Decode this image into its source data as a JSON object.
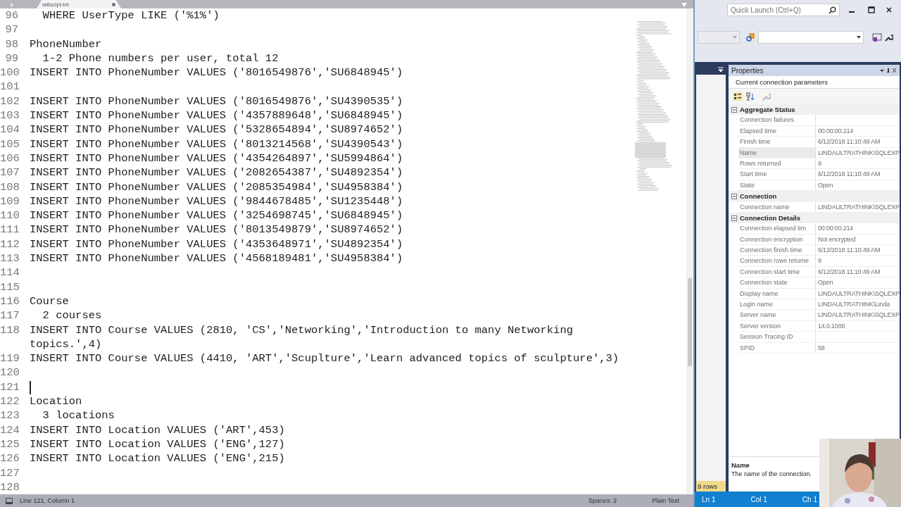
{
  "editor": {
    "tab": {
      "title": "la6scipt.txt",
      "modified": true
    },
    "lines": [
      {
        "number": "96",
        "text": "  WHERE UserType LIKE ('%1%')",
        "caret": false
      },
      {
        "number": "97",
        "caret": false
      },
      {
        "number": "98",
        "text": "PhoneNumber",
        "caret": false
      },
      {
        "number": "99",
        "text": "  1-2 Phone numbers per user, total 12",
        "caret": false
      },
      {
        "number": "100",
        "text": "INSERT INTO PhoneNumber VALUES ('8016549876','SU6848945')",
        "caret": false
      },
      {
        "number": "101",
        "caret": false
      },
      {
        "number": "102",
        "text": "INSERT INTO PhoneNumber VALUES ('8016549876','SU4390535')",
        "caret": false
      },
      {
        "number": "103",
        "text": "INSERT INTO PhoneNumber VALUES ('4357889648','SU6848945')",
        "caret": false
      },
      {
        "number": "104",
        "text": "INSERT INTO PhoneNumber VALUES ('5328654894','SU8974652')",
        "caret": false
      },
      {
        "number": "105",
        "text": "INSERT INTO PhoneNumber VALUES ('8013214568','SU4390543')",
        "caret": false
      },
      {
        "number": "106",
        "text": "INSERT INTO PhoneNumber VALUES ('4354264897','SU5994864')",
        "caret": false
      },
      {
        "number": "107",
        "text": "INSERT INTO PhoneNumber VALUES ('2082654387','SU4892354')",
        "caret": false
      },
      {
        "number": "108",
        "text": "INSERT INTO PhoneNumber VALUES ('2085354984','SU4958384')",
        "caret": false
      },
      {
        "number": "109",
        "text": "INSERT INTO PhoneNumber VALUES ('9844678485','SU1235448')",
        "caret": false
      },
      {
        "number": "110",
        "text": "INSERT INTO PhoneNumber VALUES ('3254698745','SU6848945')",
        "caret": false
      },
      {
        "number": "111",
        "text": "INSERT INTO PhoneNumber VALUES ('8013549879','SU8974652')",
        "caret": false
      },
      {
        "number": "112",
        "text": "INSERT INTO PhoneNumber VALUES ('4353648971','SU4892354')",
        "caret": false
      },
      {
        "number": "113",
        "text": "INSERT INTO PhoneNumber VALUES ('4568189481','SU4958384')",
        "caret": false
      },
      {
        "number": "114",
        "caret": false
      },
      {
        "number": "115",
        "caret": false
      },
      {
        "number": "116",
        "text": "Course",
        "caret": false
      },
      {
        "number": "117",
        "text": "  2 courses",
        "caret": false
      },
      {
        "number": "118",
        "text": "INSERT INTO Course VALUES (2810, 'CS','Networking','Introduction to many Networking",
        "wrap": "topics.',4)",
        "caret": false
      },
      {
        "number": "119",
        "text": "INSERT INTO Course VALUES (4410, 'ART','Scuplture','Learn advanced topics of sculpture',3)",
        "caret": false
      },
      {
        "number": "120",
        "caret": false
      },
      {
        "number": "121",
        "caret": true
      },
      {
        "number": "122",
        "text": "Location",
        "caret": false
      },
      {
        "number": "123",
        "text": "  3 locations",
        "caret": false
      },
      {
        "number": "124",
        "text": "INSERT INTO Location VALUES ('ART',453)",
        "caret": false
      },
      {
        "number": "125",
        "text": "INSERT INTO Location VALUES ('ENG',127)",
        "caret": false
      },
      {
        "number": "126",
        "text": "INSERT INTO Location VALUES ('ENG',215)",
        "caret": false
      },
      {
        "number": "127",
        "caret": false
      },
      {
        "number": "128",
        "caret": false
      }
    ],
    "status": {
      "position": "Line 121, Column 1",
      "indent": "Spaces: 2",
      "syntax": "Plain Text"
    }
  },
  "quick_launch": {
    "placeholder": "Quick Launch (Ctrl+Q)"
  },
  "properties": {
    "title": "Properties",
    "object": "Current connection parameters",
    "categories": [
      {
        "name": "Aggregate Status",
        "expanded": true,
        "rows": [
          {
            "name": "Connection failures",
            "selected": false
          },
          {
            "name": "Elapsed time",
            "value": "00:00:00.214",
            "selected": false
          },
          {
            "name": "Finish time",
            "value": "6/12/2018 11:10:49 AM",
            "selected": false
          },
          {
            "name": "Name",
            "value": "LINDAULTRATHINK\\SQLEXP",
            "selected": true
          },
          {
            "name": "Rows returned",
            "value": "9",
            "selected": false
          },
          {
            "name": "Start time",
            "value": "6/12/2018 11:10:49 AM",
            "selected": false
          },
          {
            "name": "State",
            "value": "Open",
            "selected": false
          }
        ]
      },
      {
        "name": "Connection",
        "expanded": true,
        "rows": [
          {
            "name": "Connection name",
            "value": "LINDAULTRATHINK\\SQLEXP",
            "selected": false
          }
        ]
      },
      {
        "name": "Connection Details",
        "expanded": true,
        "rows": [
          {
            "name": "Connection elapsed tim",
            "value": "00:00:00.214",
            "selected": false
          },
          {
            "name": "Connection encryption",
            "value": "Not encrypted",
            "selected": false
          },
          {
            "name": "Connection finish time",
            "value": "6/12/2018 11:10:49 AM",
            "selected": false
          },
          {
            "name": "Connection rows returne",
            "value": "9",
            "selected": false
          },
          {
            "name": "Connection start time",
            "value": "6/12/2018 11:10:49 AM",
            "selected": false
          },
          {
            "name": "Connection state",
            "value": "Open",
            "selected": false
          },
          {
            "name": "Display name",
            "value": "LINDAULTRATHINK\\SQLEXP",
            "selected": false
          },
          {
            "name": "Login name",
            "value": "LINDAULTRATHINK\\Linda",
            "selected": false
          },
          {
            "name": "Server name",
            "value": "LINDAULTRATHINK\\SQLEXP",
            "selected": false
          },
          {
            "name": "Server version",
            "value": "14.0.1000",
            "selected": false
          },
          {
            "name": "Session Tracing ID",
            "selected": false
          },
          {
            "name": "SPID",
            "value": "58",
            "selected": false
          }
        ]
      }
    ],
    "description": {
      "title": "Name",
      "text": "The name of the connection."
    }
  },
  "results_status": "9 rows",
  "status_bar": {
    "items": [
      "Ln 1",
      "Col 1",
      "Ch 1"
    ]
  }
}
